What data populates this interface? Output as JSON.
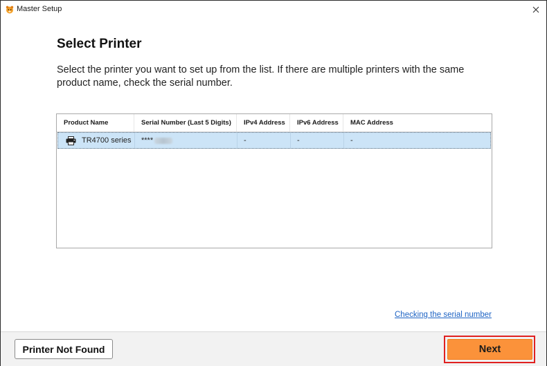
{
  "window": {
    "title": "Master Setup",
    "icon": "app-logo-icon",
    "close_icon": "close-icon"
  },
  "page": {
    "heading": "Select Printer",
    "description": "Select the printer you want to set up from the list. If there are multiple printers with the same product name, check the serial number."
  },
  "table": {
    "columns": [
      "Product Name",
      "Serial Number (Last 5 Digits)",
      "IPv4 Address",
      "IPv6 Address",
      "MAC Address"
    ],
    "rows": [
      {
        "product_name": "TR4700 series",
        "serial_number": "****",
        "serial_redacted": true,
        "ipv4": "-",
        "ipv6": "-",
        "mac": "-",
        "icon": "printer-icon",
        "selected": true
      }
    ],
    "selected_row_color": "#cce4f7"
  },
  "links": {
    "check_serial": "Checking the serial number"
  },
  "footer": {
    "printer_not_found_label": "Printer Not Found",
    "next_label": "Next",
    "next_color": "#fb923a",
    "highlight_color": "#e02020"
  }
}
